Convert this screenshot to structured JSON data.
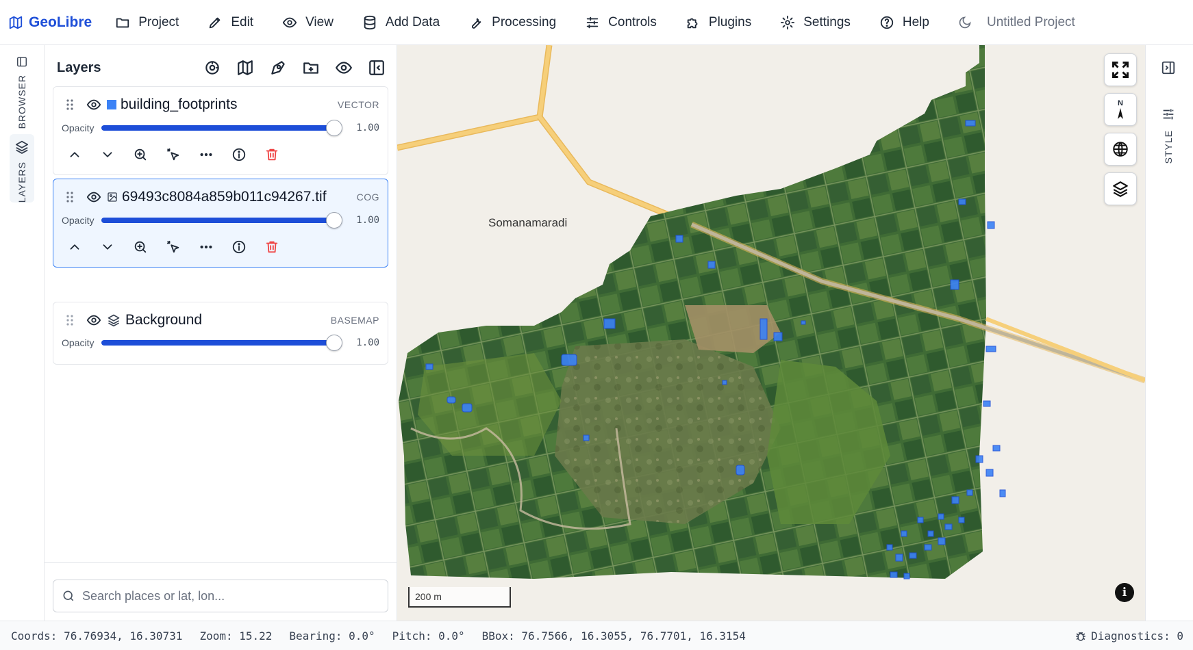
{
  "app": {
    "name": "GeoLibre",
    "project_name": "Untitled Project"
  },
  "menu": [
    {
      "label": "Project",
      "icon": "folder-icon"
    },
    {
      "label": "Edit",
      "icon": "pencil-icon"
    },
    {
      "label": "View",
      "icon": "eye-icon"
    },
    {
      "label": "Add Data",
      "icon": "database-icon"
    },
    {
      "label": "Processing",
      "icon": "wrench-icon"
    },
    {
      "label": "Controls",
      "icon": "sliders-icon"
    },
    {
      "label": "Plugins",
      "icon": "puzzle-icon"
    },
    {
      "label": "Settings",
      "icon": "gear-icon"
    },
    {
      "label": "Help",
      "icon": "help-circle-icon"
    }
  ],
  "left_rail": {
    "browser_label": "BROWSER",
    "layers_label": "LAYERS"
  },
  "layers_panel": {
    "title": "Layers",
    "opacity_label": "Opacity",
    "layers": [
      {
        "name": "building_footprints",
        "type": "VECTOR",
        "opacity": "1.00",
        "opacity_fraction": 1.0,
        "visible": true,
        "selected": false,
        "color": "#3b82f6"
      },
      {
        "name": "69493c8084a859b011c94267.tif",
        "type": "COG",
        "opacity": "1.00",
        "opacity_fraction": 1.0,
        "visible": true,
        "selected": true
      },
      {
        "name": "Background",
        "type": "BASEMAP",
        "opacity": "1.00",
        "opacity_fraction": 1.0,
        "visible": true,
        "selected": false
      }
    ],
    "search_placeholder": "Search places or lat, lon..."
  },
  "map": {
    "place_label": "Somanamaradi",
    "scale_label": "200 m",
    "north_label": "N",
    "road_color": "#f6cf7a",
    "footprint_color": "#3b82f6"
  },
  "right_rail": {
    "style_label": "STYLE"
  },
  "status": {
    "coords": "Coords: 76.76934, 16.30731",
    "zoom": "Zoom: 15.22",
    "bearing": "Bearing: 0.0°",
    "pitch": "Pitch: 0.0°",
    "bbox": "BBox: 76.7566, 16.3055, 76.7701, 16.3154",
    "diagnostics": "Diagnostics: 0"
  }
}
